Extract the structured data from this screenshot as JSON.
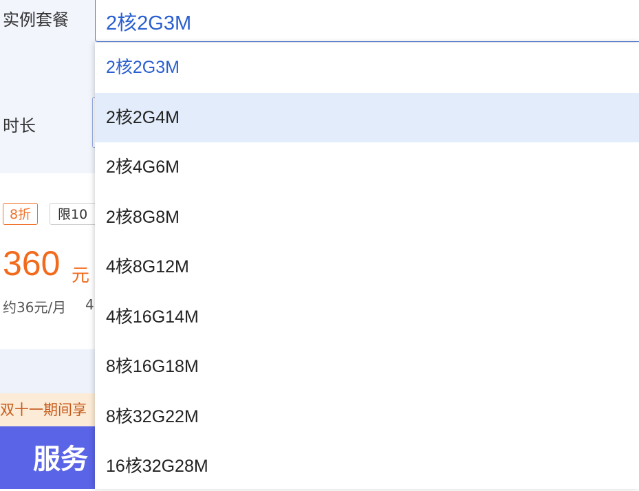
{
  "form": {
    "instance_label": "实例套餐",
    "duration_label": "时长"
  },
  "price_card": {
    "discount_tag": "8折",
    "limit_tag": "限10",
    "price": "360",
    "price_unit": "元",
    "monthly": "约36元/月",
    "monthly_extra": "4"
  },
  "promo": {
    "text": "双十一期间享"
  },
  "service": {
    "title": "服务"
  },
  "dropdown": {
    "selected_value": "2核2G3M",
    "hovered_index": 1,
    "options": [
      {
        "label": "2核2G3M",
        "state": "selected"
      },
      {
        "label": "2核2G4M",
        "state": "hovered"
      },
      {
        "label": "2核4G6M",
        "state": "normal"
      },
      {
        "label": "2核8G8M",
        "state": "normal"
      },
      {
        "label": "4核8G12M",
        "state": "normal"
      },
      {
        "label": "4核16G14M",
        "state": "normal"
      },
      {
        "label": "8核16G18M",
        "state": "normal"
      },
      {
        "label": "8核32G22M",
        "state": "normal"
      },
      {
        "label": "16核32G28M",
        "state": "normal"
      }
    ]
  },
  "colors": {
    "accent_blue": "#2a5fcf",
    "price_orange": "#f26a1b",
    "hover_bg": "#e3ecfa",
    "service_banner": "#5a64e6"
  }
}
